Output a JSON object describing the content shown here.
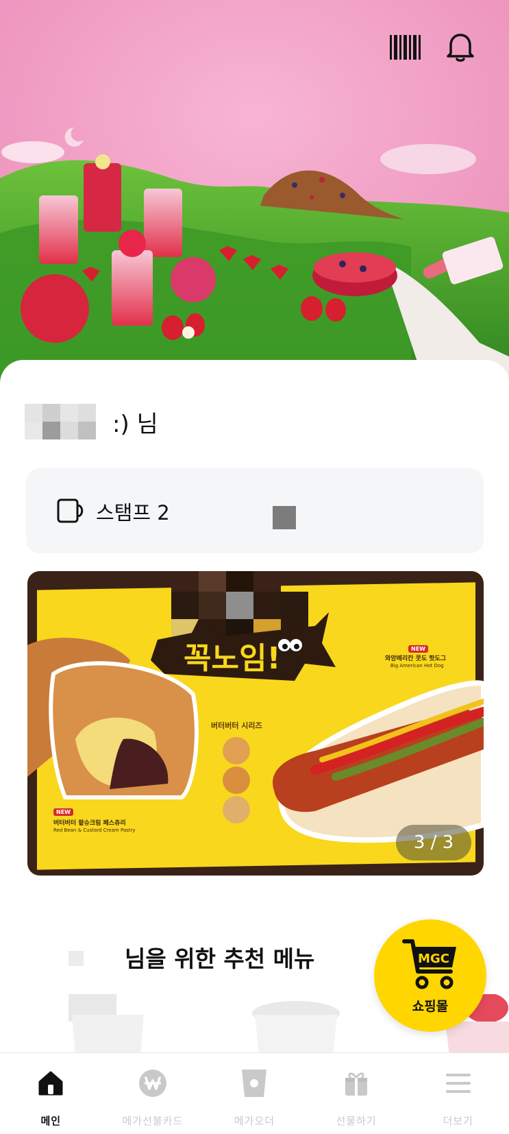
{
  "header": {
    "icons": [
      "barcode-icon",
      "bell-icon"
    ]
  },
  "greeting": {
    "suffix": ":) 님"
  },
  "stamp": {
    "label": "스탬프 2"
  },
  "banner": {
    "new_badge": "NEW",
    "left_product_ko": "버터버터 팥슈크림 페스츄리",
    "left_product_en": "Red Bean & Custard Cream Pastry",
    "right_product_ko": "와앙메리칸 콧도 핫도그",
    "right_product_en": "Big American Hot Dog",
    "series_label": "버터버터 시리즈",
    "page_indicator": "3 / 3"
  },
  "recommend": {
    "title": "님을 위한 추천 메뉴"
  },
  "fab": {
    "label": "쇼핑몰"
  },
  "bottom_nav": {
    "items": [
      {
        "label": "메인",
        "icon": "home-icon",
        "active": true
      },
      {
        "label": "메가선불카드",
        "icon": "won-coin-icon",
        "active": false
      },
      {
        "label": "메가오더",
        "icon": "cup-icon",
        "active": false
      },
      {
        "label": "선물하기",
        "icon": "gift-icon",
        "active": false
      },
      {
        "label": "더보기",
        "icon": "menu-icon",
        "active": false
      }
    ]
  },
  "colors": {
    "accent_yellow": "#ffd600",
    "hero_pink": "#f3a9c9",
    "hill_green": "#3f9a2a",
    "nav_inactive": "#c9c9c9"
  }
}
